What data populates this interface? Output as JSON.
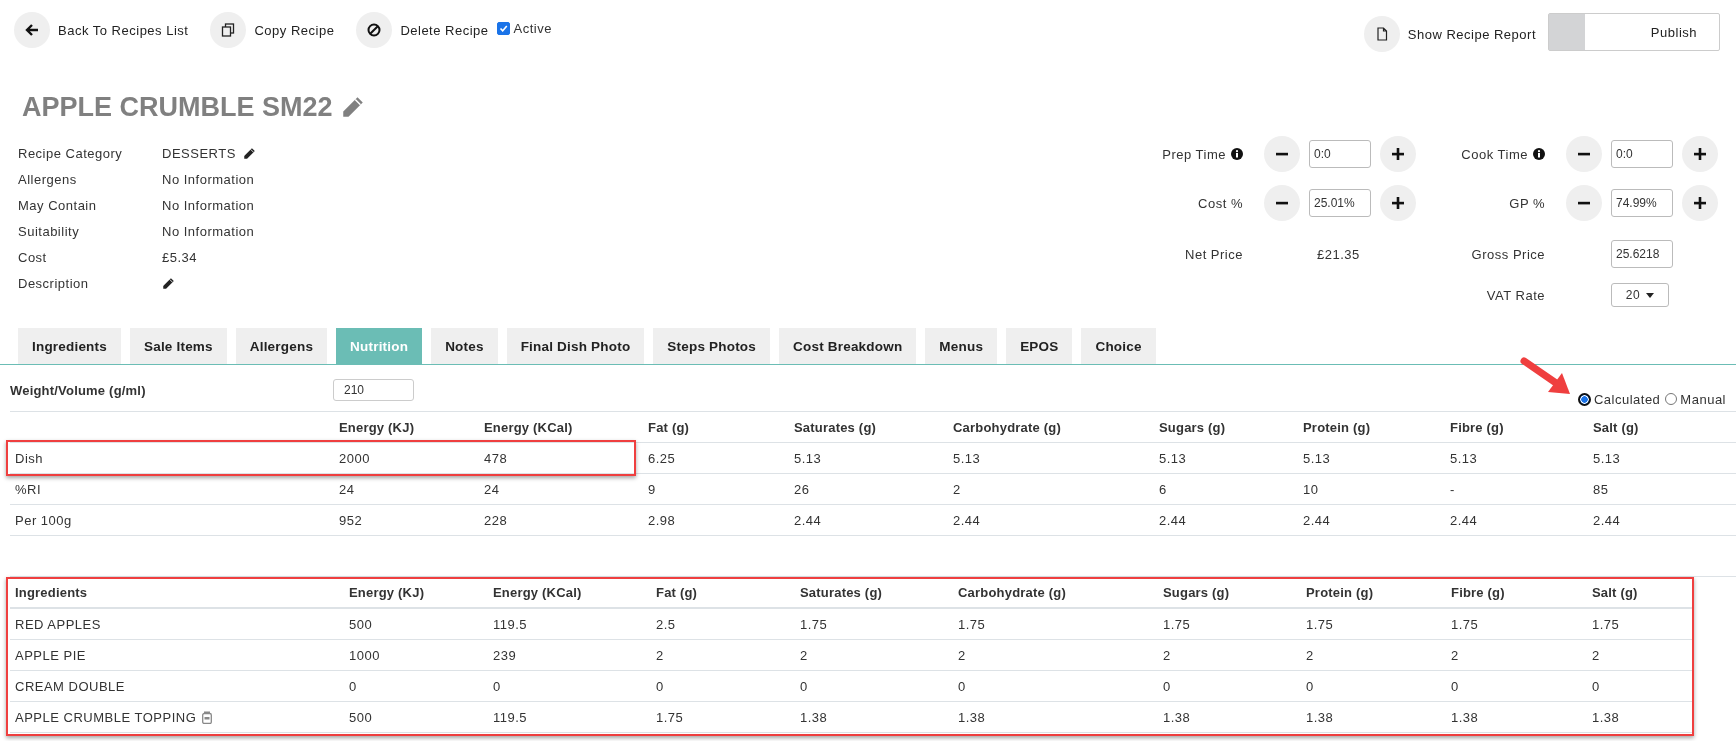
{
  "toolbar": {
    "actions": [
      {
        "kind": "back",
        "label": "Back To Recipes List"
      },
      {
        "kind": "copy",
        "label": "Copy Recipe"
      },
      {
        "kind": "delete",
        "label": "Delete Recipe"
      }
    ],
    "active": {
      "label": "Active",
      "checked": true
    },
    "report": {
      "label": "Show Recipe Report"
    },
    "publish": {
      "label": "Publish",
      "on": false
    }
  },
  "title": "APPLE CRUMBLE SM22",
  "details": [
    {
      "label": "Recipe Category",
      "value": "DESSERTS",
      "editable": true
    },
    {
      "label": "Allergens",
      "value": "No Information",
      "editable": false
    },
    {
      "label": "May Contain",
      "value": "No Information",
      "editable": false
    },
    {
      "label": "Suitability",
      "value": "No Information",
      "editable": false
    },
    {
      "label": "Cost",
      "value": "£5.34",
      "editable": false
    },
    {
      "label": "Description",
      "editable": true
    }
  ],
  "pricing": [
    {
      "left": {
        "kind": "stepper",
        "label": "Prep Time",
        "value": "0:0",
        "info": true
      },
      "right": {
        "kind": "stepper",
        "label": "Cook Time",
        "value": "0:0",
        "info": true
      }
    },
    {
      "left": {
        "kind": "stepper",
        "label": "Cost %",
        "value": "25.01%",
        "info": false
      },
      "right": {
        "kind": "stepper",
        "label": "GP %",
        "value": "74.99%",
        "info": false
      }
    },
    {
      "left": {
        "kind": "text",
        "label": "Net Price",
        "value": "£21.35"
      },
      "right": {
        "kind": "input",
        "label": "Gross Price",
        "value": "25.6218"
      }
    },
    {
      "right": {
        "kind": "select",
        "label": "VAT Rate",
        "value": "20"
      }
    }
  ],
  "tabs": [
    {
      "label": "Ingredients",
      "selected": false
    },
    {
      "label": "Sale Items",
      "selected": false
    },
    {
      "label": "Allergens",
      "selected": false
    },
    {
      "label": "Nutrition",
      "selected": true
    },
    {
      "label": "Notes",
      "selected": false
    },
    {
      "label": "Final Dish Photo",
      "selected": false
    },
    {
      "label": "Steps Photos",
      "selected": false
    },
    {
      "label": "Cost Breakdown",
      "selected": false
    },
    {
      "label": "Menus",
      "selected": false
    },
    {
      "label": "EPOS",
      "selected": false
    },
    {
      "label": "Choice",
      "selected": false
    }
  ],
  "weight": {
    "label": "Weight/Volume (g/ml)",
    "value": "210"
  },
  "mode": [
    {
      "label": "Calculated",
      "selected": true,
      "pointer": true
    },
    {
      "label": "Manual",
      "selected": false,
      "pointer": false
    }
  ],
  "nutrition": {
    "columns": [
      "Energy (KJ)",
      "Energy (KCal)",
      "Fat (g)",
      "Saturates (g)",
      "Carbohydrate (g)",
      "Sugars (g)",
      "Protein (g)",
      "Fibre (g)",
      "Salt (g)"
    ],
    "rows": [
      {
        "label": "Dish",
        "values": [
          "2000",
          "478",
          "6.25",
          "5.13",
          "5.13",
          "5.13",
          "5.13",
          "5.13",
          "5.13"
        ],
        "highlighted": true
      },
      {
        "label": "%RI",
        "values": [
          "24",
          "24",
          "9",
          "26",
          "2",
          "6",
          "10",
          "-",
          "85"
        ],
        "highlighted": false
      },
      {
        "label": "Per 100g",
        "values": [
          "952",
          "228",
          "2.98",
          "2.44",
          "2.44",
          "2.44",
          "2.44",
          "2.44",
          "2.44"
        ],
        "highlighted": false
      }
    ]
  },
  "ingredients": {
    "highlighted": true,
    "columns": [
      "Ingredients",
      "Energy (KJ)",
      "Energy (KCal)",
      "Fat (g)",
      "Saturates (g)",
      "Carbohydrate (g)",
      "Sugars (g)",
      "Protein (g)",
      "Fibre (g)",
      "Salt (g)"
    ],
    "rows": [
      {
        "name": "RED APPLES",
        "sub_recipe": false,
        "values": [
          "500",
          "119.5",
          "2.5",
          "1.75",
          "1.75",
          "1.75",
          "1.75",
          "1.75",
          "1.75"
        ]
      },
      {
        "name": "APPLE PIE",
        "sub_recipe": false,
        "values": [
          "1000",
          "239",
          "2",
          "2",
          "2",
          "2",
          "2",
          "2",
          "2"
        ]
      },
      {
        "name": "CREAM DOUBLE",
        "sub_recipe": false,
        "values": [
          "0",
          "0",
          "0",
          "0",
          "0",
          "0",
          "0",
          "0",
          "0"
        ]
      },
      {
        "name": "APPLE CRUMBLE TOPPING",
        "sub_recipe": true,
        "values": [
          "500",
          "119.5",
          "1.75",
          "1.38",
          "1.38",
          "1.38",
          "1.38",
          "1.38",
          "1.38"
        ]
      }
    ]
  }
}
